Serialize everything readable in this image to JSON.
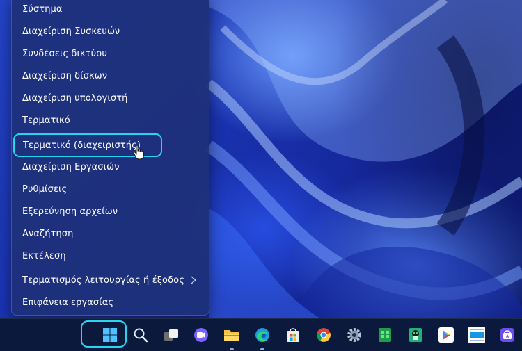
{
  "start_context_menu": {
    "items": [
      {
        "label": "Σύστημα"
      },
      {
        "label": "Διαχείριση Συσκευών"
      },
      {
        "label": "Συνδέσεις δικτύου"
      },
      {
        "label": "Διαχείριση δίσκων"
      },
      {
        "label": "Διαχείριση υπολογιστή"
      },
      {
        "label": "Τερματικό"
      },
      {
        "label": "Τερματικό (διαχειριστής)",
        "highlighted": true
      },
      {
        "label": "Διαχείριση Εργασιών"
      },
      {
        "label": "Ρυθμίσεις"
      },
      {
        "label": "Εξερεύνηση αρχείων"
      },
      {
        "label": "Αναζήτηση"
      },
      {
        "label": "Εκτέλεση"
      },
      {
        "label": "Τερματισμός λειτουργίας ή έξοδος",
        "has_submenu": true
      },
      {
        "label": "Επιφάνεια εργασίας"
      }
    ],
    "highlight_color": "#2ad4f0"
  },
  "taskbar": {
    "icons": [
      {
        "name": "windows-start-icon",
        "highlighted": true
      },
      {
        "name": "search-icon"
      },
      {
        "name": "task-view-icon"
      },
      {
        "name": "chat-icon"
      },
      {
        "name": "file-explorer-icon",
        "running": true
      },
      {
        "name": "edge-icon",
        "running": true
      },
      {
        "name": "microsoft-store-icon"
      },
      {
        "name": "chrome-icon"
      },
      {
        "name": "settings-gear-icon"
      },
      {
        "name": "spreadsheet-app-icon"
      },
      {
        "name": "android-app-icon"
      },
      {
        "name": "play-store-icon"
      },
      {
        "name": "appstore-icon"
      },
      {
        "name": "shopping-bag-app-icon"
      }
    ]
  }
}
